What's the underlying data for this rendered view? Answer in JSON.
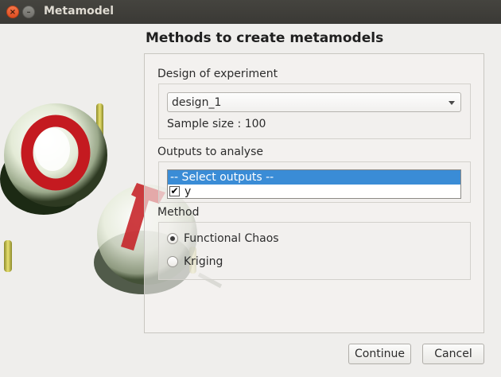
{
  "window": {
    "title": "Metamodel",
    "close_glyph": "×",
    "minimize_glyph": "–"
  },
  "heading": "Methods to create metamodels",
  "design": {
    "section_label": "Design of experiment",
    "selected": "design_1",
    "sample_size_text": "Sample size : 100"
  },
  "outputs": {
    "section_label": "Outputs to analyse",
    "placeholder": "-- Select outputs --",
    "items": [
      {
        "label": "y",
        "checked": true,
        "check_glyph": "✔"
      }
    ]
  },
  "method": {
    "section_label": "Method",
    "options": [
      {
        "label": "Functional Chaos",
        "selected": true
      },
      {
        "label": "Kriging",
        "selected": false
      }
    ]
  },
  "buttons": {
    "continue": "Continue",
    "cancel": "Cancel"
  },
  "colors": {
    "titlebar": "#3d3c38",
    "selection": "#3a8cd6",
    "close_button": "#e95420"
  },
  "icons": [
    "close-icon",
    "minimize-icon",
    "chevron-down-icon",
    "checkbox-icon",
    "radio-icon",
    "openturns-logo"
  ]
}
